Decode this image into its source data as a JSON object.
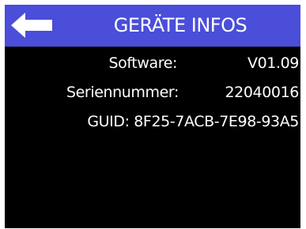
{
  "header": {
    "title": "GERÄTE INFOS",
    "back_icon": "arrow-left-icon",
    "background_color": "#4a4ed8"
  },
  "device_info": {
    "software_label": "Software:",
    "software_value": "V01.09",
    "serial_label": "Seriennummer:",
    "serial_value": "22040016",
    "guid_text": "GUID: 8F25-7ACB-7E98-93A5"
  }
}
